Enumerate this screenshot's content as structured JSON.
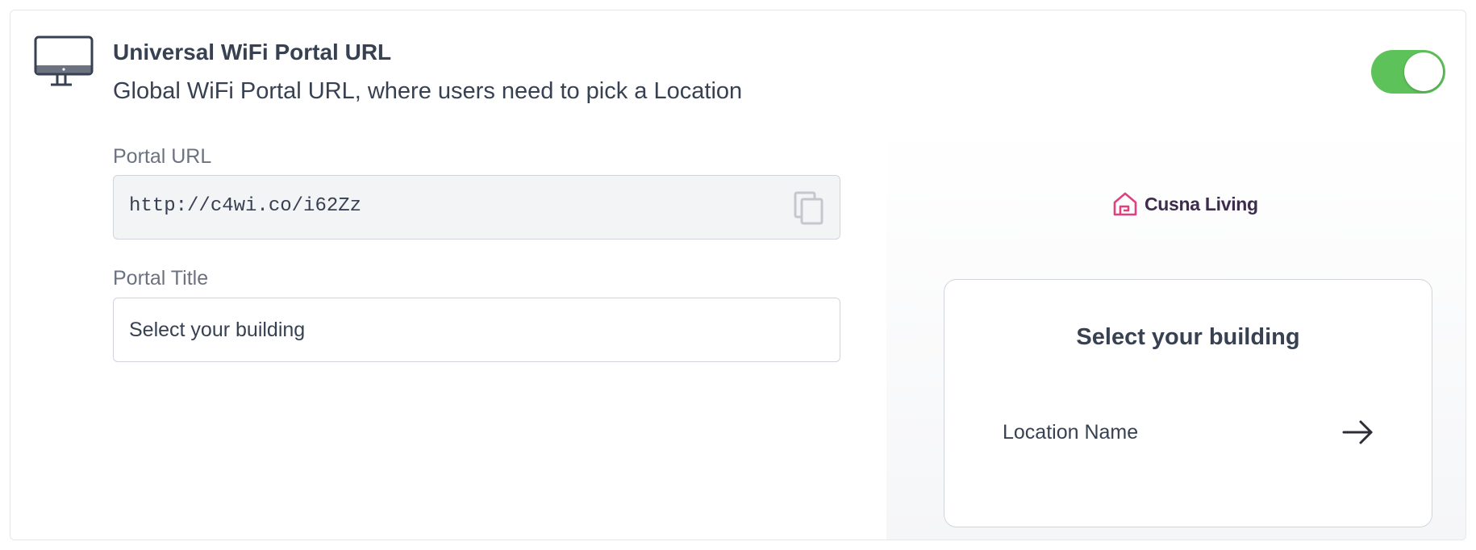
{
  "section": {
    "title": "Universal WiFi Portal URL",
    "subtitle": "Global WiFi Portal URL, where users need to pick a Location",
    "icon": "monitor-icon",
    "toggle_enabled": true,
    "toggle_color": "#5ec25a"
  },
  "form": {
    "portal_url_label": "Portal URL",
    "portal_url_value": "http://c4wi.co/i62Zz",
    "copy_icon": "copy-icon",
    "portal_title_label": "Portal Title",
    "portal_title_value": "Select your building"
  },
  "preview": {
    "brand_name": "Cusna Living",
    "brand_icon": "house-logo-icon",
    "brand_color": "#e0407e",
    "title": "Select your building",
    "location_name": "Location Name",
    "arrow_icon": "arrow-right-icon"
  }
}
